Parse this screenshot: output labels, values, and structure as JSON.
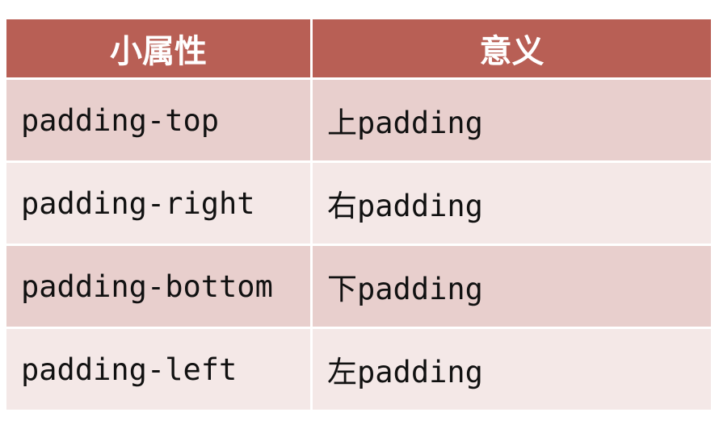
{
  "table": {
    "headers": [
      "小属性",
      "意义"
    ],
    "rows": [
      [
        "padding-top",
        "上padding"
      ],
      [
        "padding-right",
        "右padding"
      ],
      [
        "padding-bottom",
        "下padding"
      ],
      [
        "padding-left",
        "左padding"
      ]
    ]
  },
  "colors": {
    "header_bg": "#b85f55",
    "header_text": "#ffffff",
    "row_dark": "#e8cfcd",
    "row_light": "#f4e8e7"
  }
}
